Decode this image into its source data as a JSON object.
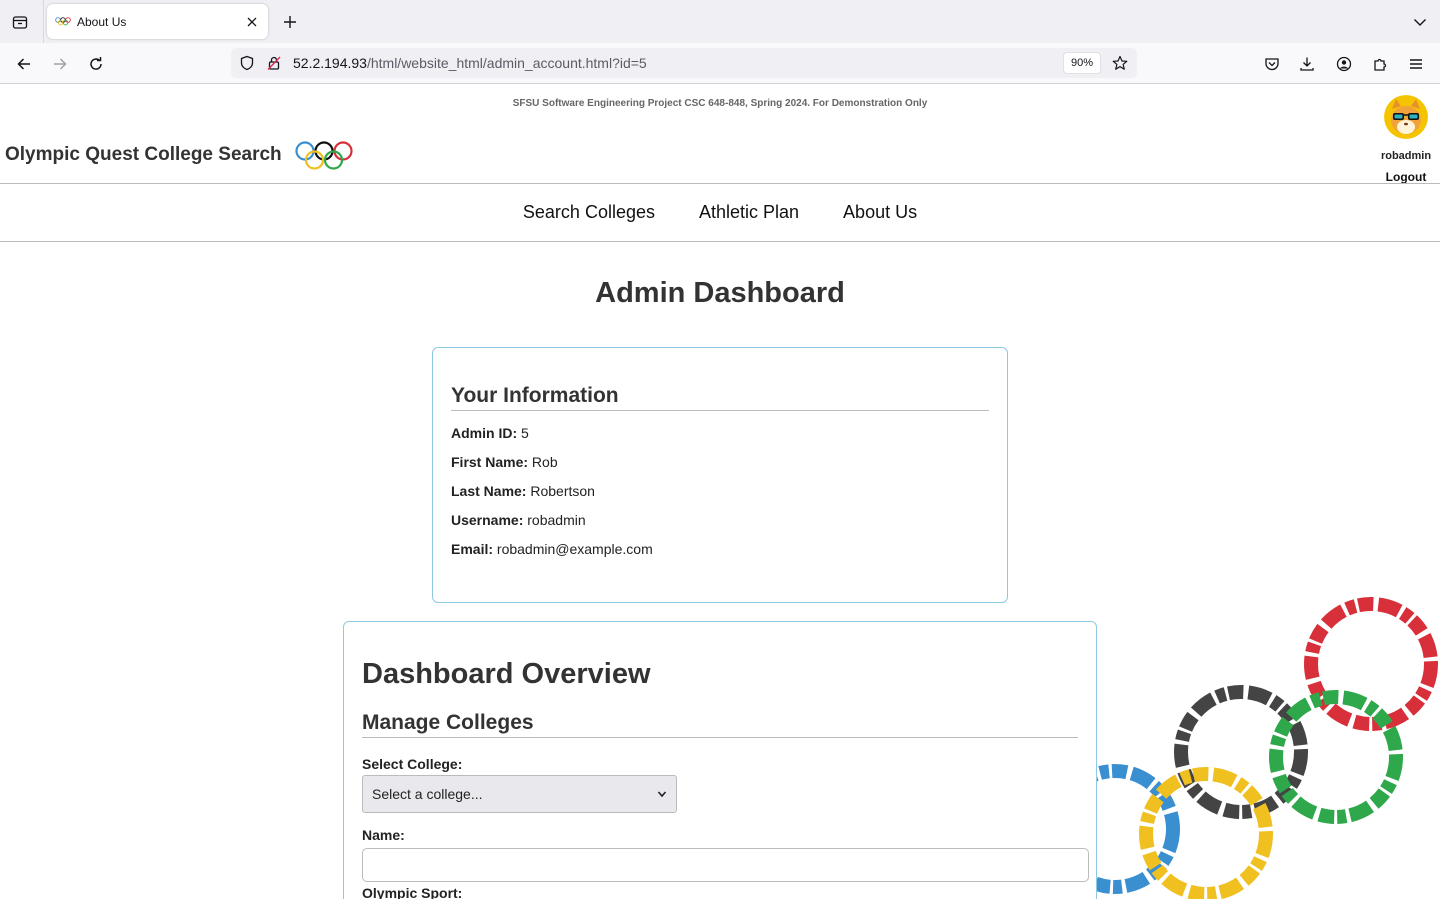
{
  "browser": {
    "tab": {
      "title": "About Us"
    },
    "url": {
      "host": "52.2.194.93",
      "path": "/html/website_html/admin_account.html?id=5"
    },
    "zoom": "90%"
  },
  "header": {
    "disclaimer": "SFSU Software Engineering Project CSC 648-848, Spring 2024. For Demonstration Only",
    "site_title": "Olympic Quest College Search",
    "username": "robadmin",
    "logout_label": "Logout"
  },
  "nav": {
    "items": [
      {
        "label": "Search Colleges"
      },
      {
        "label": "Athletic Plan"
      },
      {
        "label": "About Us"
      }
    ]
  },
  "main": {
    "title": "Admin Dashboard",
    "info": {
      "heading": "Your Information",
      "rows": [
        {
          "label": "Admin ID:",
          "value": "5"
        },
        {
          "label": "First Name:",
          "value": "Rob"
        },
        {
          "label": "Last Name:",
          "value": "Robertson"
        },
        {
          "label": "Username:",
          "value": "robadmin"
        },
        {
          "label": "Email:",
          "value": "robadmin@example.com"
        }
      ]
    },
    "dashboard": {
      "heading": "Dashboard Overview",
      "section": "Manage Colleges",
      "select_college_label": "Select College:",
      "select_college_value": "Select a college...",
      "name_label": "Name:",
      "name_value": "",
      "sport_label": "Olympic Sport:"
    }
  },
  "colors": {
    "card_border": "#8ecae6",
    "ring_blue": "#3a8fd0",
    "ring_black": "#444444",
    "ring_red": "#d8303a",
    "ring_yellow": "#f0c020",
    "ring_green": "#2ea84a"
  }
}
